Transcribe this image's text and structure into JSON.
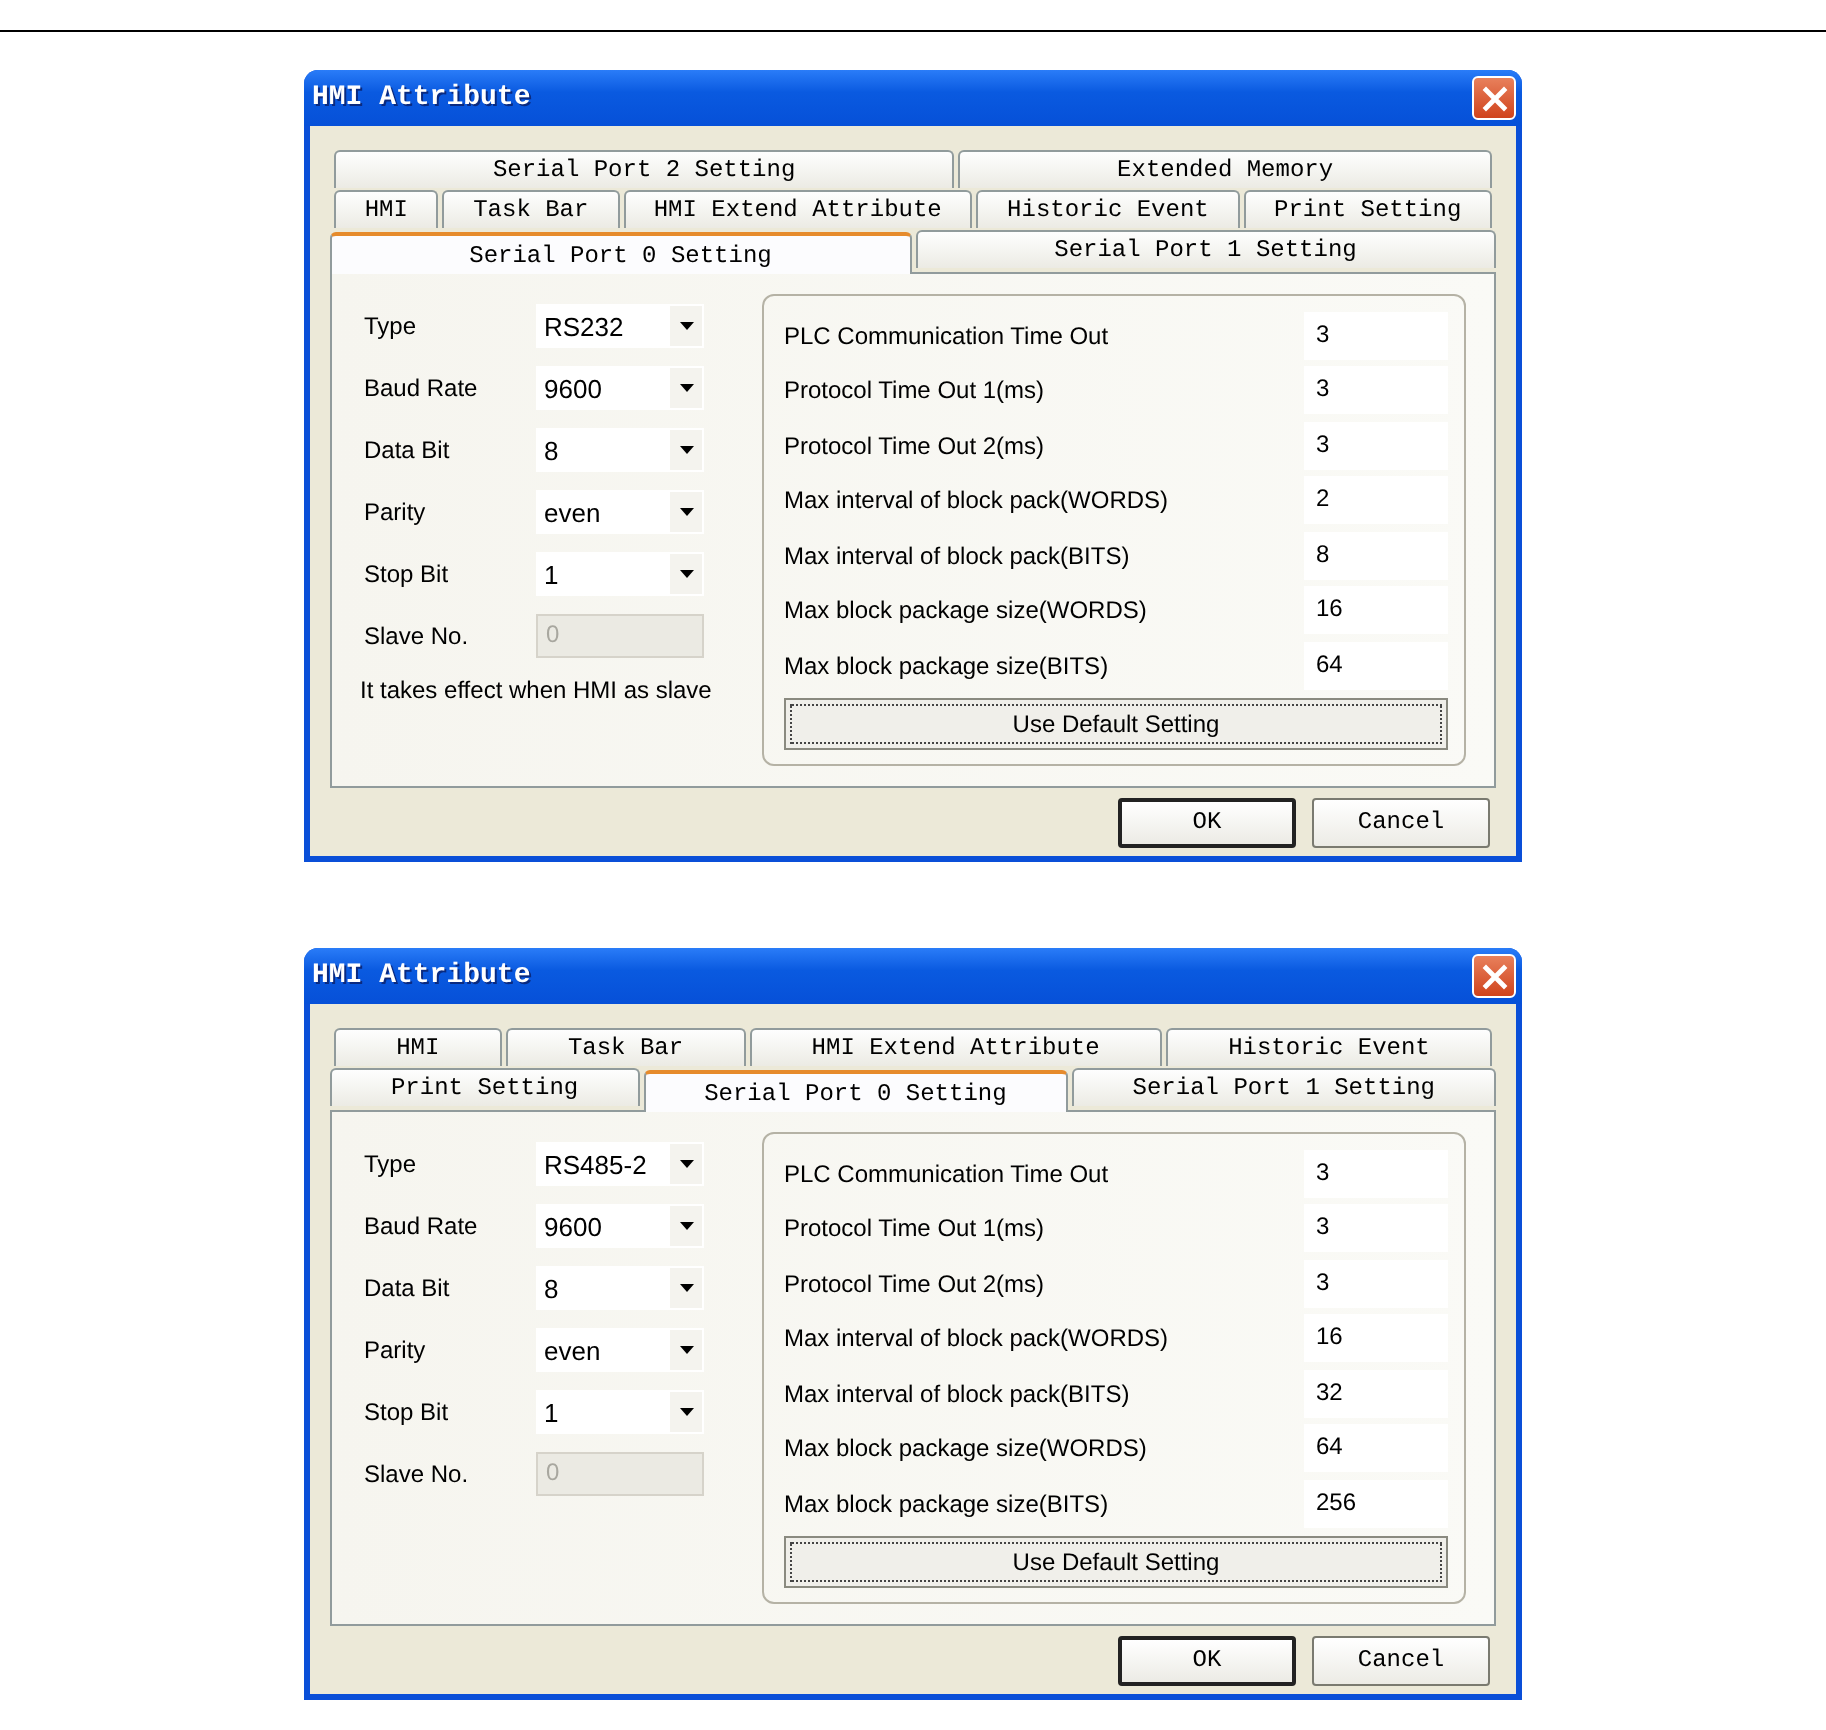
{
  "dialogs": [
    {
      "title": "HMI Attribute",
      "tab_rows": [
        [
          {
            "label": "Serial Port 2 Setting",
            "selected": false
          },
          {
            "label": "Extended Memory",
            "selected": false
          }
        ],
        [
          {
            "label": "HMI",
            "selected": false
          },
          {
            "label": "Task Bar",
            "selected": false
          },
          {
            "label": "HMI Extend Attribute",
            "selected": false
          },
          {
            "label": "Historic Event",
            "selected": false
          },
          {
            "label": "Print Setting",
            "selected": false
          }
        ],
        [
          {
            "label": "Serial Port 0 Setting",
            "selected": true
          },
          {
            "label": "Serial Port 1 Setting",
            "selected": false
          }
        ]
      ],
      "fields": [
        {
          "label": "Type",
          "value": "RS232",
          "kind": "combo",
          "disabled": false
        },
        {
          "label": "Baud Rate",
          "value": "9600",
          "kind": "combo",
          "disabled": false
        },
        {
          "label": "Data Bit",
          "value": "8",
          "kind": "combo",
          "disabled": false
        },
        {
          "label": "Parity",
          "value": "even",
          "kind": "combo",
          "disabled": false
        },
        {
          "label": "Stop Bit",
          "value": "1",
          "kind": "combo",
          "disabled": false
        },
        {
          "label": "Slave No.",
          "value": "0",
          "kind": "input",
          "disabled": true
        }
      ],
      "note": "It takes effect when HMI as slave",
      "params": [
        {
          "label": "PLC Communication Time Out",
          "value": "3"
        },
        {
          "label": "Protocol Time Out 1(ms)",
          "value": "3"
        },
        {
          "label": "Protocol Time Out 2(ms)",
          "value": "3"
        },
        {
          "label": "Max interval of block pack(WORDS)",
          "value": "2"
        },
        {
          "label": "Max interval of block pack(BITS)",
          "value": "8"
        },
        {
          "label": "Max block package size(WORDS)",
          "value": "16"
        },
        {
          "label": "Max block package size(BITS)",
          "value": "64"
        }
      ],
      "default_button": "Use Default Setting",
      "buttons": [
        {
          "label": "OK",
          "default": true
        },
        {
          "label": "Cancel",
          "default": false
        }
      ]
    },
    {
      "title": "HMI Attribute",
      "tab_rows": [
        [
          {
            "label": "HMI",
            "selected": false
          },
          {
            "label": "Task Bar",
            "selected": false
          },
          {
            "label": "HMI Extend Attribute",
            "selected": false
          },
          {
            "label": "Historic Event",
            "selected": false
          }
        ],
        [
          {
            "label": "Print Setting",
            "selected": false
          },
          {
            "label": "Serial Port 0 Setting",
            "selected": true
          },
          {
            "label": "Serial Port 1 Setting",
            "selected": false
          }
        ]
      ],
      "fields": [
        {
          "label": "Type",
          "value": "RS485-2",
          "kind": "combo",
          "disabled": false
        },
        {
          "label": "Baud Rate",
          "value": "9600",
          "kind": "combo",
          "disabled": false
        },
        {
          "label": "Data Bit",
          "value": "8",
          "kind": "combo",
          "disabled": false
        },
        {
          "label": "Parity",
          "value": "even",
          "kind": "combo",
          "disabled": false
        },
        {
          "label": "Stop Bit",
          "value": "1",
          "kind": "combo",
          "disabled": false
        },
        {
          "label": "Slave No.",
          "value": "0",
          "kind": "input",
          "disabled": true
        }
      ],
      "params": [
        {
          "label": "PLC Communication Time Out",
          "value": "3"
        },
        {
          "label": "Protocol Time Out 1(ms)",
          "value": "3"
        },
        {
          "label": "Protocol Time Out 2(ms)",
          "value": "3"
        },
        {
          "label": "Max interval of block pack(WORDS)",
          "value": "16"
        },
        {
          "label": "Max interval of block pack(BITS)",
          "value": "32"
        },
        {
          "label": "Max block package size(WORDS)",
          "value": "64"
        },
        {
          "label": "Max block package size(BITS)",
          "value": "256"
        }
      ],
      "default_button": "Use Default Setting",
      "buttons": [
        {
          "label": "OK",
          "default": true
        },
        {
          "label": "Cancel",
          "default": false
        }
      ]
    }
  ]
}
